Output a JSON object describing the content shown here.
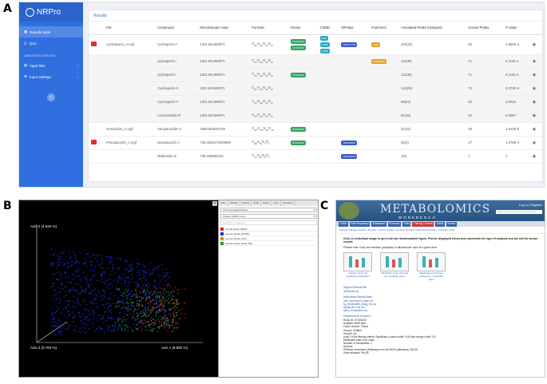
{
  "panel_labels": {
    "a": "A",
    "b": "B",
    "c": "C"
  },
  "nrpro": {
    "logo": "NRPro",
    "nav": {
      "results_table": "Results table",
      "quit": "Quit",
      "section": "UNMODIFIED SPECTRA",
      "input_files": "Input files",
      "input_settings": "Input settings"
    },
    "card_title": "Results",
    "columns": [
      "",
      "File",
      "Compound",
      "Monoisotopic mass",
      "Formula",
      "Norine",
      "ChEBI",
      "NPAtlas",
      "PubChem",
      "Annotated Peaks (Isotopes)",
      "Scored Peaks",
      "P Value",
      ""
    ],
    "rows": [
      {
        "file": "Cyclosporin_A.mgf",
        "compound": "cyclosporin A",
        "mass": "1201.841368071",
        "f_base": "C",
        "f_1": "62",
        "f_2": "H",
        "f_3": "111",
        "f_4": "N",
        "f_5": "11",
        "f_6": "O",
        "f_7": "12",
        "norine": [
          "NOR00040",
          "NOR00033"
        ],
        "chebi": [
          "4031",
          "67255",
          "41959"
        ],
        "npatlas": "NPA017735",
        "pubchem": "5284",
        "peaks": "125(32)",
        "scored": "84",
        "pval": "1.865E-4",
        "expand": true,
        "hl": false
      },
      {
        "file": "",
        "compound": "cyclosporin-I",
        "mass": "1201.841368071",
        "f_base": "C",
        "f_1": "62",
        "f_2": "H",
        "f_3": "111",
        "f_4": "N",
        "f_5": "11",
        "f_6": "O",
        "f_7": "12",
        "norine": [],
        "chebi": [],
        "npatlas": "",
        "pubchem": "102065073",
        "peaks": "111(30)",
        "scored": "71",
        "pval": "6.111E-4",
        "expand": false,
        "hl": true
      },
      {
        "file": "",
        "compound": "cyclosporin I",
        "mass": "1201.841368071",
        "f_base": "C",
        "f_1": "62",
        "f_2": "H",
        "f_3": "111",
        "f_4": "N",
        "f_5": "11",
        "f_6": "O",
        "f_7": "12",
        "norine": [
          "NOR00041"
        ],
        "chebi": [],
        "npatlas": "",
        "pubchem": "",
        "peaks": "111(30)",
        "scored": "71",
        "pval": "6.111E-4",
        "expand": false,
        "hl": true
      },
      {
        "file": "",
        "compound": "Cyclosporin-X",
        "mass": "1201.841368071",
        "f_base": "C",
        "f_1": "62",
        "f_2": "H",
        "f_3": "111",
        "f_4": "N",
        "f_5": "11",
        "f_6": "O",
        "f_7": "12",
        "norine": [],
        "chebi": [],
        "npatlas": "",
        "pubchem": "",
        "peaks": "113(29)",
        "scored": "72",
        "pval": "8.073E-4",
        "expand": false,
        "hl": true
      },
      {
        "file": "",
        "compound": "Cyclosporin-Y",
        "mass": "1201.841368071",
        "f_base": "C",
        "f_1": "62",
        "f_2": "H",
        "f_3": "111",
        "f_4": "N",
        "f_5": "11",
        "f_6": "O",
        "f_7": "12",
        "norine": [],
        "chebi": [],
        "npatlas": "",
        "pubchem": "",
        "peaks": "99(24)",
        "scored": "63",
        "pval": "0.0016",
        "expand": false,
        "hl": true
      },
      {
        "file": "",
        "compound": "Leucinostatin R",
        "mass": "1201.841368071",
        "f_base": "C",
        "f_1": "62",
        "f_2": "H",
        "f_3": "111",
        "f_4": "N",
        "f_5": "11",
        "f_6": "O",
        "f_7": "12",
        "norine": [],
        "chebi": [],
        "npatlas": "",
        "pubchem": "",
        "peaks": "61(16)",
        "scored": "34",
        "pval": "0.0067",
        "expand": false,
        "hl": true
      },
      {
        "file": "Gramicidin_C.mgf",
        "compound": "Val-gramicidin C",
        "mass": "1858.054548739",
        "f_base": "C",
        "f_1": "99",
        "f_2": "H",
        "f_3": "139",
        "f_4": "N",
        "f_5": "19",
        "f_6": "O",
        "f_7": "18",
        "norine": [
          "NOR00148"
        ],
        "chebi": [],
        "npatlas": "",
        "pubchem": "",
        "peaks": "42(15)",
        "scored": "26",
        "pval": "1.643E-6",
        "expand": false,
        "hl": false
      },
      {
        "file": "Pseudacyclin_A.mgf",
        "compound": "pseudacyclin A",
        "mass": "739.4632473409999",
        "f_base": "C",
        "f_1": "38",
        "f_2": "H",
        "f_3": "61",
        "f_4": "N",
        "f_5": "7",
        "f_6": "O",
        "f_7": "7",
        "norine": [
          "NOR01187"
        ],
        "chebi": [],
        "npatlas": "NPA008090",
        "pubchem": "",
        "peaks": "25(0)",
        "scored": "17",
        "pval": "1.376E-4",
        "expand": true,
        "hl": false
      },
      {
        "file": "",
        "compound": "Wollamide B",
        "mass": "739.438095223",
        "f_base": "C",
        "f_1": "37",
        "f_2": "H",
        "f_3": "61",
        "f_4": "N",
        "f_5": "9",
        "f_6": "O",
        "f_7": "7",
        "norine": [],
        "chebi": [],
        "npatlas": "NPA000099",
        "pubchem": "",
        "peaks": "1(0)",
        "scored": "1",
        "pval": "1",
        "expand": false,
        "hl": false
      }
    ]
  },
  "emperor": {
    "axis1": "Axis 1 (9.882 %)",
    "axis2": "Axis 2 (4.534 %)",
    "axis3": "Axis 3 (3.783 %)",
    "tabs": [
      "Color",
      "Visibility",
      "Opacity",
      "Scale",
      "Shape",
      "Axes",
      "Animations"
    ],
    "select": "Chromatographicphase",
    "scheme": "Classic QIIME Colors",
    "search_placeholder": "Search for a category",
    "groups": [
      {
        "label": "normal phase (#621)",
        "color": "#e02020"
      },
      {
        "label": "reverse phase (#1345)",
        "color": "#2030d8"
      },
      {
        "label": "reverse phase (116)",
        "color": "#e08a20"
      },
      {
        "label": "reverse phase (polar 416)",
        "color": "#20a030"
      }
    ]
  },
  "mw": {
    "title": "METABOLOMICS",
    "subtitle": "WORKBENCH",
    "login": "Log in | Register",
    "search_placeholder": "Search the Metabolomics Workbench",
    "nav": [
      "Home",
      "Data Repository",
      "Databases",
      "Protocols",
      "Tools",
      "Training / Events",
      "About",
      "Search"
    ],
    "subnav": "Upload | Manage Studies | Browse / Search Studies | Analysis Studies | Data Sharing Policy | Tutorials | FAQ",
    "intro1": "Click on individual image to get a full size downloadable figure. Picture displayed below just represents the type of analysis and are not the actual results.",
    "intro2": "Please note: Only one session (analysis) is allowed per user at a given time.",
    "thumbs": [
      "Volcano plot of all significant metabolites",
      "Metabolite count grouped by metabolite class",
      "Metabolite enrichment grouped by metabolite class"
    ],
    "zipped_title": "Zipped Result file",
    "zipped_link": "AllResults.zip",
    "individual_title": "Individual Result files",
    "files": [
      "met_enrichment_class.csv",
      "kg_metabolites_kegg_ids.csv",
      "significant_met.csv",
      "stats_metabolites.csv"
    ],
    "params_title": "Parameters Chosen:",
    "params": [
      "Study ID: ST001003",
      "Analysis: NMR data",
      "Factor column: Tissue",
      "Group1: Mutiber",
      "Group2: ink",
      "p.adj: Y4  fdr filtering criteria: Significant  p-value cutoff: 0.05  fold change cutoff: 0.5",
      "Metabolite class: sub_class",
      "Number of metabolites: 3",
      "Species:",
      "Pathway enrichment (Pathways from all KEGG pathways): FALSE",
      "Gene analysis: FALSE"
    ]
  }
}
